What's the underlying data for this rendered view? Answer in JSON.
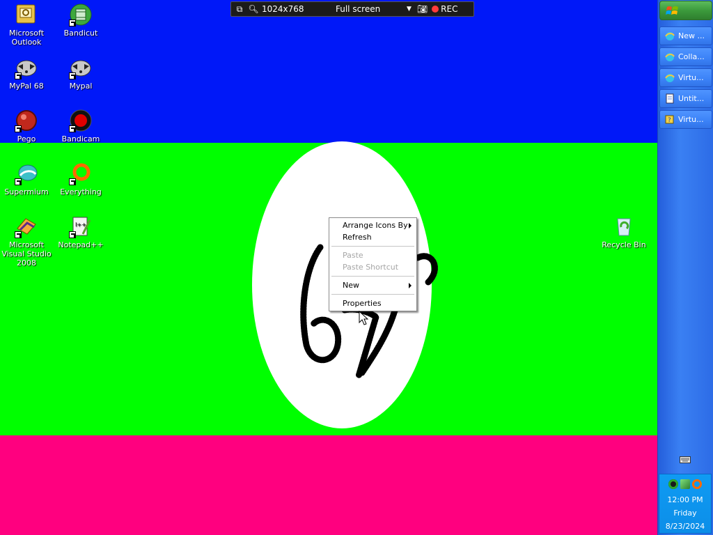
{
  "recorder": {
    "resolution": "1024x768",
    "mode": "Full screen",
    "rec_label": "REC",
    "rec_color": "#ff3b3b"
  },
  "desktop": {
    "wallpaper_colors": {
      "top": "#0018f8",
      "middle": "#00ff00",
      "bottom": "#ff007f",
      "oval": "#ffffff"
    },
    "icons": [
      {
        "label": "Microsoft Outlook",
        "icon": "outlook-icon"
      },
      {
        "label": "Bandicut",
        "icon": "bandicut-icon"
      },
      {
        "label": "MyPal 68",
        "icon": "mypal-raccoon-icon"
      },
      {
        "label": "Mypal",
        "icon": "mypal-raccoon-icon"
      },
      {
        "label": "Pego",
        "icon": "pego-icon"
      },
      {
        "label": "Bandicam",
        "icon": "bandicam-icon"
      },
      {
        "label": "Supermium",
        "icon": "supermium-icon"
      },
      {
        "label": "Everything",
        "icon": "everything-icon"
      },
      {
        "label": "Microsoft Visual Studio 2008",
        "icon": "visual-studio-icon"
      },
      {
        "label": "Notepad++",
        "icon": "notepadpp-icon"
      },
      {
        "label": "Recycle Bin",
        "icon": "recycle-bin-icon"
      }
    ]
  },
  "context_menu": {
    "items": [
      {
        "label": "Arrange Icons By",
        "enabled": true,
        "submenu": true
      },
      {
        "label": "Refresh",
        "enabled": true,
        "submenu": false
      },
      {
        "label": "Paste",
        "enabled": false,
        "submenu": false
      },
      {
        "label": "Paste Shortcut",
        "enabled": false,
        "submenu": false
      },
      {
        "label": "New",
        "enabled": true,
        "submenu": true
      },
      {
        "label": "Properties",
        "enabled": true,
        "submenu": false
      }
    ]
  },
  "taskbar": {
    "buttons": [
      {
        "label": "New ...",
        "icon": "ie-icon"
      },
      {
        "label": "Colla...",
        "icon": "ie-icon"
      },
      {
        "label": "Virtu...",
        "icon": "ie-icon"
      },
      {
        "label": "Untit...",
        "icon": "notepad-icon"
      },
      {
        "label": "Virtu...",
        "icon": "help-icon"
      }
    ],
    "clock": {
      "time": "12:00 PM",
      "day": "Friday",
      "date": "8/23/2024"
    }
  }
}
